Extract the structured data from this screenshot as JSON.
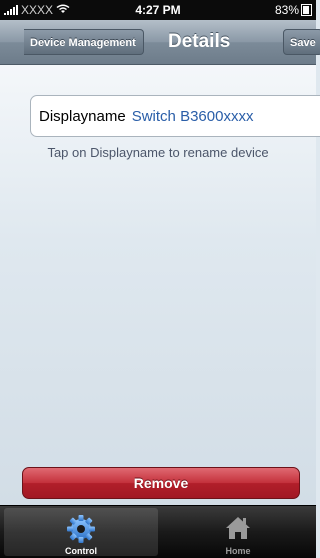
{
  "status_bar": {
    "carrier": "XXXX",
    "time": "4:27 PM",
    "battery": "83%"
  },
  "nav": {
    "back_label": "Device Management",
    "title": "Details",
    "save_label": "Save"
  },
  "device": {
    "name_label": "Displayname",
    "name_value": "Switch B3600xxxx",
    "hint": "Tap on Displayname to rename device"
  },
  "actions": {
    "remove_label": "Remove"
  },
  "tabs": [
    {
      "label": "Control",
      "icon": "gear-icon",
      "selected": true
    },
    {
      "label": "Home",
      "icon": "home-icon",
      "selected": false
    }
  ],
  "colors": {
    "nav_bar": "#8a98a6",
    "remove_button": "#c3303b",
    "value_text": "#2a5ea8",
    "gear_icon": "#5a9ee8"
  }
}
